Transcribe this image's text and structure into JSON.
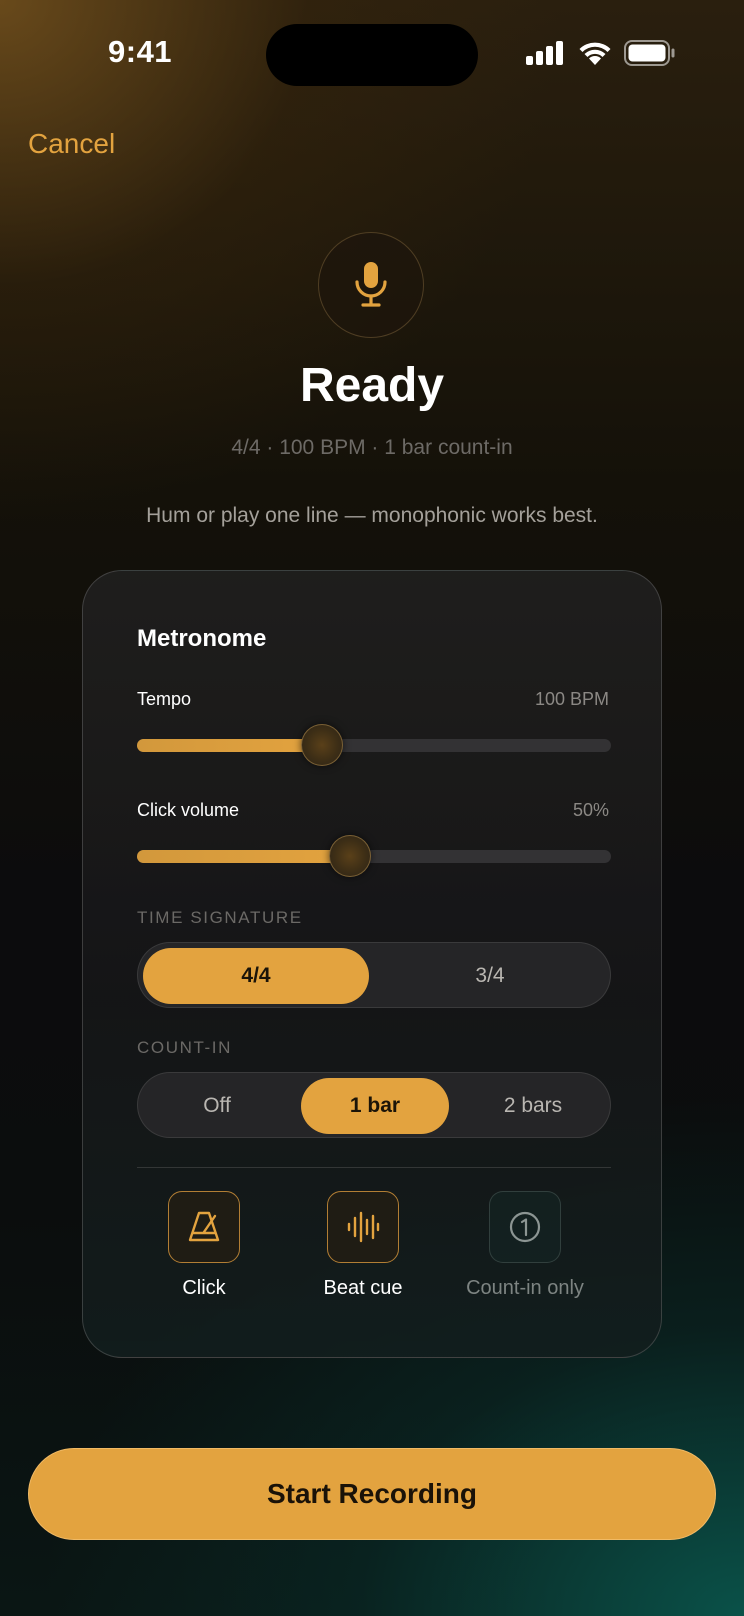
{
  "status_bar": {
    "time": "9:41",
    "icons": [
      "signal-icon",
      "wifi-icon",
      "battery-icon"
    ]
  },
  "header": {
    "cancel_label": "Cancel"
  },
  "hero": {
    "icon": "microphone-icon",
    "title": "Ready",
    "subtitle": "4/4 · 100 BPM · 1 bar count-in",
    "hint": "Hum or play one line — monophonic works best."
  },
  "metronome": {
    "title": "Metronome",
    "tempo": {
      "label": "Tempo",
      "value_text": "100 BPM",
      "fraction": 0.39
    },
    "click_volume": {
      "label": "Click volume",
      "value_text": "50%",
      "fraction": 0.45
    },
    "time_signature": {
      "label": "TIME SIGNATURE",
      "options": [
        "4/4",
        "3/4"
      ],
      "selected": "4/4"
    },
    "count_in": {
      "label": "COUNT-IN",
      "options": [
        "Off",
        "1 bar",
        "2 bars"
      ],
      "selected": "1 bar"
    },
    "cue_options": [
      {
        "label": "Click",
        "icon": "metronome-icon",
        "active": true
      },
      {
        "label": "Beat cue",
        "icon": "waveform-icon",
        "active": true
      },
      {
        "label": "Count-in only",
        "icon": "number-one-circle-icon",
        "active": false
      }
    ]
  },
  "footer": {
    "start_label": "Start Recording"
  },
  "colors": {
    "accent": "#e3a33f",
    "card_border": "#6e6e6e",
    "muted_text": "#6d6a66"
  }
}
